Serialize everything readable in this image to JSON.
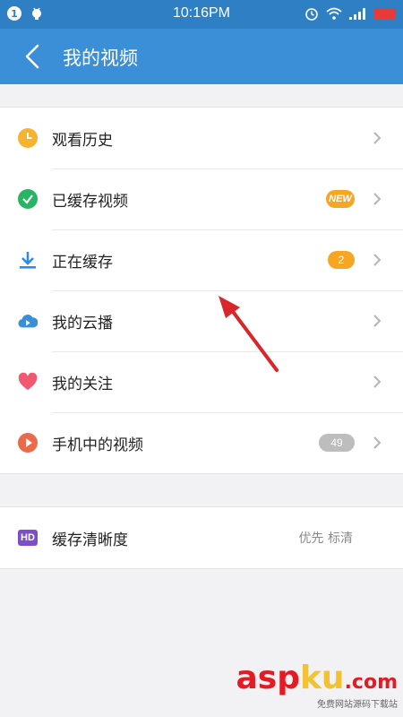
{
  "status_bar": {
    "notification_count": "1",
    "time": "10:16PM"
  },
  "header": {
    "title": "我的视频"
  },
  "menu": [
    {
      "label": "观看历史",
      "icon": "clock-icon",
      "badge": ""
    },
    {
      "label": "已缓存视频",
      "icon": "check-circle-icon",
      "badge": "NEW"
    },
    {
      "label": "正在缓存",
      "icon": "download-icon",
      "badge": "2"
    },
    {
      "label": "我的云播",
      "icon": "cloud-play-icon",
      "badge": ""
    },
    {
      "label": "我的关注",
      "icon": "heart-icon",
      "badge": ""
    },
    {
      "label": "手机中的视频",
      "icon": "play-circle-icon",
      "badge": "49"
    }
  ],
  "settings": {
    "icon_text": "HD",
    "label": "缓存清晰度",
    "value": "优先 标清"
  },
  "watermark": {
    "main": "asp",
    "accent": "ku",
    "suffix": ".com",
    "small": "免费网站源码下载站"
  },
  "colors": {
    "status_bar": "#2f7fc4",
    "app_bar": "#3a8fd6",
    "badge_orange": "#f6a623",
    "arrow_red": "#d9262b"
  }
}
